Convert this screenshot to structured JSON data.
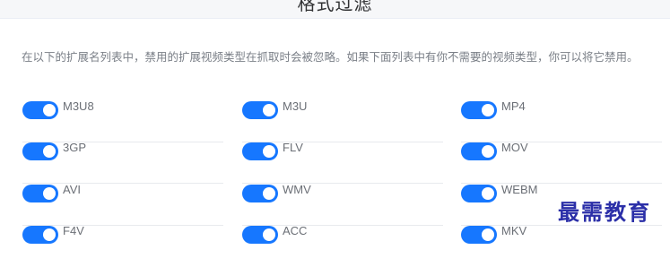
{
  "header": {
    "title": "格式过滤"
  },
  "description": "在以下的扩展名列表中，禁用的扩展视频类型在抓取时会被忽略。如果下面列表中有你不需要的视频类型，你可以将它禁用。",
  "formats": [
    {
      "label": "M3U8",
      "enabled": true
    },
    {
      "label": "M3U",
      "enabled": true
    },
    {
      "label": "MP4",
      "enabled": true
    },
    {
      "label": "3GP",
      "enabled": true
    },
    {
      "label": "FLV",
      "enabled": true
    },
    {
      "label": "MOV",
      "enabled": true
    },
    {
      "label": "AVI",
      "enabled": true
    },
    {
      "label": "WMV",
      "enabled": true
    },
    {
      "label": "WEBM",
      "enabled": true
    },
    {
      "label": "F4V",
      "enabled": true
    },
    {
      "label": "ACC",
      "enabled": true
    },
    {
      "label": "MKV",
      "enabled": true
    }
  ],
  "watermark": "最需教育",
  "colors": {
    "toggle_on": "#1677ff",
    "watermark": "#2b2fa8"
  }
}
